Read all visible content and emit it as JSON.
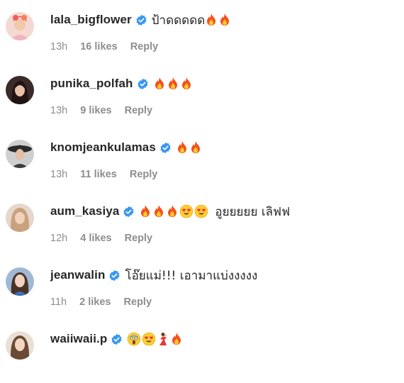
{
  "accent_verified": "#3897f0",
  "comments": [
    {
      "username": "lala_bigflower",
      "text": "ป้าดดดดด",
      "emojis": [
        "fire",
        "fire"
      ],
      "time": "13h",
      "likes": "16 likes",
      "reply": "Reply",
      "avatar": "avatar-lala"
    },
    {
      "username": "punika_polfah",
      "text": "",
      "emojis": [
        "fire",
        "fire",
        "fire"
      ],
      "time": "13h",
      "likes": "9 likes",
      "reply": "Reply",
      "avatar": "avatar-punika"
    },
    {
      "username": "knomjeankulamas",
      "text": "",
      "emojis": [
        "fire",
        "fire"
      ],
      "time": "13h",
      "likes": "11 likes",
      "reply": "Reply",
      "avatar": "avatar-knomjean"
    },
    {
      "username": "aum_kasiya",
      "text": "อูยยยยย เลิฟฟ",
      "emojis": [
        "fire",
        "fire",
        "fire",
        "heart-eyes",
        "heart-eyes"
      ],
      "emojis_before_text": true,
      "time": "12h",
      "likes": "4 likes",
      "reply": "Reply",
      "avatar": "avatar-aum"
    },
    {
      "username": "jeanwalin",
      "text": "โอ๊ยแม่!!! เอามาแบ่งงงงง",
      "emojis": [],
      "time": "11h",
      "likes": "2 likes",
      "reply": "Reply",
      "avatar": "avatar-jeanwalin"
    },
    {
      "username": "waiiwaii.p",
      "text": "",
      "emojis": [
        "scream",
        "heart-eyes",
        "dancer",
        "fire"
      ],
      "time": "",
      "likes": "",
      "reply": "",
      "avatar": "avatar-waii"
    }
  ]
}
